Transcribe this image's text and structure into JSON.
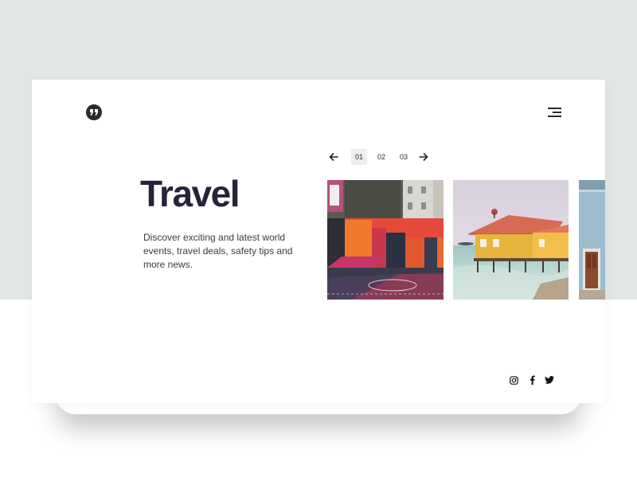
{
  "header": {
    "logo_icon": "quote-marks-icon",
    "menu_icon": "hamburger-menu-icon"
  },
  "pagination": {
    "prev_icon": "arrow-left-icon",
    "next_icon": "arrow-right-icon",
    "pages": [
      "01",
      "02",
      "03"
    ],
    "active_page": "01"
  },
  "hero": {
    "title": "Travel",
    "description": "Discover exciting and latest world events, travel deals, safety tips and more news."
  },
  "gallery": {
    "images": [
      {
        "subject": "colorful painted basketball court with buildings"
      },
      {
        "subject": "yellow stilt house with red roof over sea"
      },
      {
        "subject": "light blue building with wooden door"
      }
    ]
  },
  "social": {
    "icons": [
      "instagram-icon",
      "facebook-icon",
      "twitter-icon"
    ]
  },
  "colors": {
    "page_background": "#e1e6e6",
    "card_background": "#ffffff",
    "text_dark": "#25243a",
    "active_page_bg": "#eeeeee"
  }
}
